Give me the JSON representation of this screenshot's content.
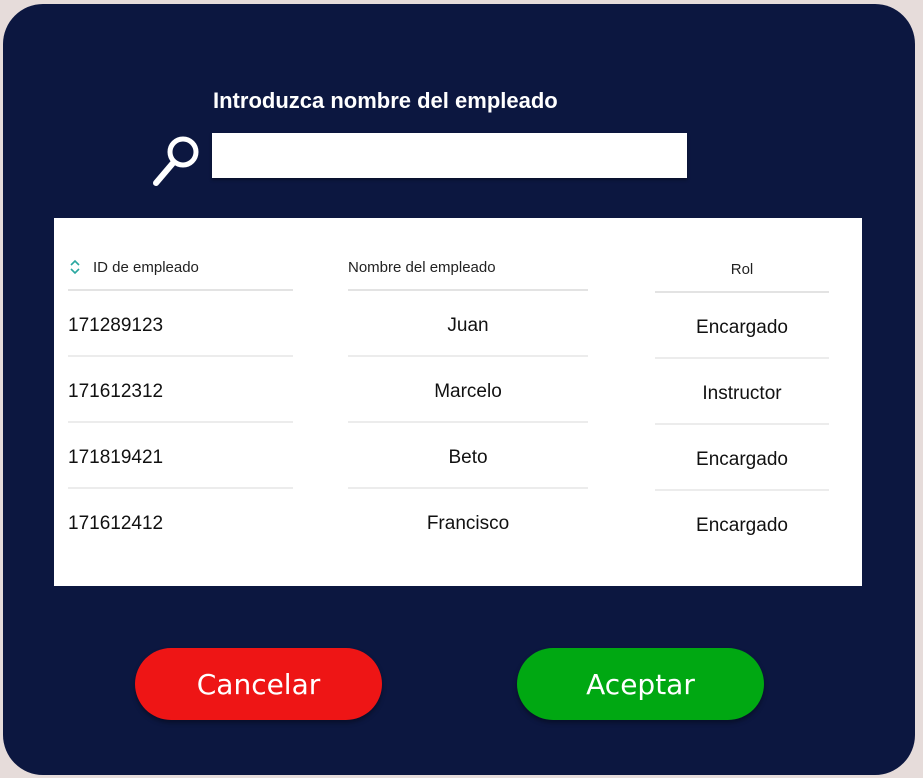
{
  "search": {
    "title": "Introduzca nombre del empleado",
    "value": "",
    "placeholder": ""
  },
  "table": {
    "headers": {
      "id": "ID de empleado",
      "name": "Nombre del empleado",
      "role": "Rol"
    },
    "rows": [
      {
        "id": "171289123",
        "name": "Juan",
        "role": "Encargado"
      },
      {
        "id": "171612312",
        "name": "Marcelo",
        "role": "Instructor"
      },
      {
        "id": "171819421",
        "name": "Beto",
        "role": "Encargado"
      },
      {
        "id": "171612412",
        "name": "Francisco",
        "role": "Encargado"
      }
    ]
  },
  "buttons": {
    "cancel": "Cancelar",
    "accept": "Aceptar"
  },
  "colors": {
    "background": "#0c1740",
    "cancel": "#ee1515",
    "accept": "#00a812",
    "sort_icon": "#2aa7a0"
  },
  "icons": {
    "search": "search-icon",
    "sort": "sort-icon"
  }
}
